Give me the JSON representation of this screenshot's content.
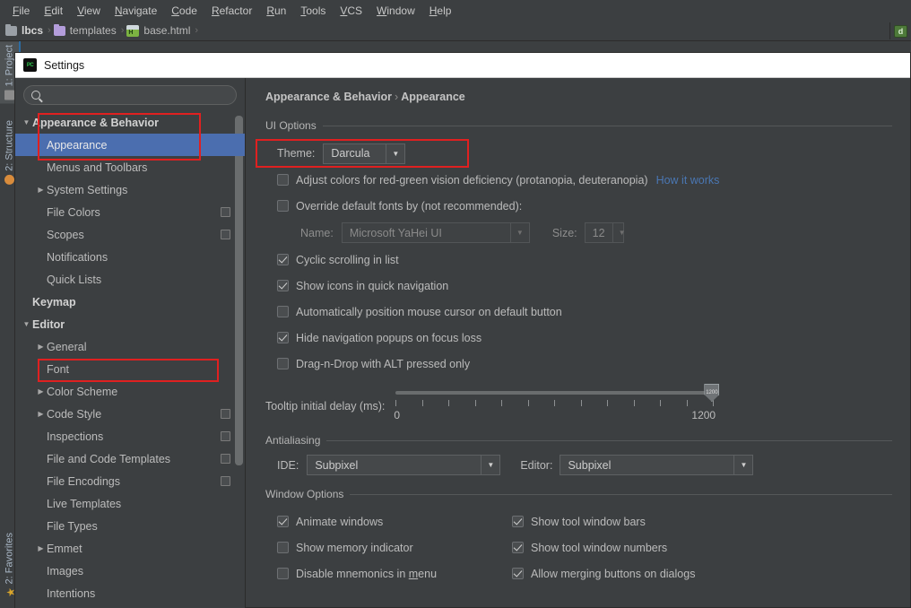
{
  "menubar": {
    "items": [
      "File",
      "Edit",
      "View",
      "Navigate",
      "Code",
      "Refactor",
      "Run",
      "Tools",
      "VCS",
      "Window",
      "Help"
    ]
  },
  "navbar": {
    "crumbs": [
      {
        "label": "lbcs",
        "icon": "folder-gray-icon"
      },
      {
        "label": "templates",
        "icon": "folder-purple-icon"
      },
      {
        "label": "base.html",
        "icon": "html-file-icon"
      }
    ],
    "separator": "›",
    "right_icon": "run-configuration-icon"
  },
  "toolstripe": {
    "buttons": [
      {
        "label": "1: Project",
        "icon": "project-icon",
        "active": true
      },
      {
        "label": "2: Structure",
        "icon": "structure-icon",
        "active": false
      },
      {
        "label": "2: Favorites",
        "icon": "star-icon",
        "active": false
      }
    ]
  },
  "dialog": {
    "icon": "pycharm-icon",
    "title": "Settings"
  },
  "search": {
    "placeholder": "",
    "value": "",
    "icon": "search-icon"
  },
  "tree": {
    "items": [
      {
        "label": "Appearance & Behavior",
        "arrow": "▼",
        "indent": 0,
        "bold": true,
        "selected": false,
        "badge": false
      },
      {
        "label": "Appearance",
        "arrow": "",
        "indent": 1,
        "bold": false,
        "selected": true,
        "badge": false
      },
      {
        "label": "Menus and Toolbars",
        "arrow": "",
        "indent": 1,
        "bold": false,
        "selected": false,
        "badge": false
      },
      {
        "label": "System Settings",
        "arrow": "▶",
        "indent": 1,
        "bold": false,
        "selected": false,
        "badge": false
      },
      {
        "label": "File Colors",
        "arrow": "",
        "indent": 1,
        "bold": false,
        "selected": false,
        "badge": true
      },
      {
        "label": "Scopes",
        "arrow": "",
        "indent": 1,
        "bold": false,
        "selected": false,
        "badge": true
      },
      {
        "label": "Notifications",
        "arrow": "",
        "indent": 1,
        "bold": false,
        "selected": false,
        "badge": false
      },
      {
        "label": "Quick Lists",
        "arrow": "",
        "indent": 1,
        "bold": false,
        "selected": false,
        "badge": false
      },
      {
        "label": "Keymap",
        "arrow": "",
        "indent": 0,
        "bold": true,
        "selected": false,
        "badge": false
      },
      {
        "label": "Editor",
        "arrow": "▼",
        "indent": 0,
        "bold": true,
        "selected": false,
        "badge": false
      },
      {
        "label": "General",
        "arrow": "▶",
        "indent": 1,
        "bold": false,
        "selected": false,
        "badge": false
      },
      {
        "label": "Font",
        "arrow": "",
        "indent": 1,
        "bold": false,
        "selected": false,
        "badge": false
      },
      {
        "label": "Color Scheme",
        "arrow": "▶",
        "indent": 1,
        "bold": false,
        "selected": false,
        "badge": false
      },
      {
        "label": "Code Style",
        "arrow": "▶",
        "indent": 1,
        "bold": false,
        "selected": false,
        "badge": true
      },
      {
        "label": "Inspections",
        "arrow": "",
        "indent": 1,
        "bold": false,
        "selected": false,
        "badge": true
      },
      {
        "label": "File and Code Templates",
        "arrow": "",
        "indent": 1,
        "bold": false,
        "selected": false,
        "badge": true
      },
      {
        "label": "File Encodings",
        "arrow": "",
        "indent": 1,
        "bold": false,
        "selected": false,
        "badge": true
      },
      {
        "label": "Live Templates",
        "arrow": "",
        "indent": 1,
        "bold": false,
        "selected": false,
        "badge": false
      },
      {
        "label": "File Types",
        "arrow": "",
        "indent": 1,
        "bold": false,
        "selected": false,
        "badge": false
      },
      {
        "label": "Emmet",
        "arrow": "▶",
        "indent": 1,
        "bold": false,
        "selected": false,
        "badge": false
      },
      {
        "label": "Images",
        "arrow": "",
        "indent": 1,
        "bold": false,
        "selected": false,
        "badge": false
      },
      {
        "label": "Intentions",
        "arrow": "",
        "indent": 1,
        "bold": false,
        "selected": false,
        "badge": false
      }
    ]
  },
  "content": {
    "breadcrumb_parent": "Appearance & Behavior",
    "breadcrumb_sep": "›",
    "breadcrumb_current": "Appearance",
    "ui_options": {
      "title": "UI Options",
      "theme_label": "Theme:",
      "theme_value": "Darcula",
      "vision_deficiency_label": "Adjust colors for red-green vision deficiency (protanopia, deuteranopia)",
      "vision_deficiency_checked": false,
      "how_it_works_link": "How it works",
      "override_fonts_label": "Override default fonts by (not recommended):",
      "override_fonts_checked": false,
      "name_label": "Name:",
      "name_value": "Microsoft YaHei UI",
      "size_label": "Size:",
      "size_value": "12",
      "checkboxes": [
        {
          "label": "Cyclic scrolling in list",
          "checked": true
        },
        {
          "label": "Show icons in quick navigation",
          "checked": true
        },
        {
          "label": "Automatically position mouse cursor on default button",
          "checked": false
        },
        {
          "label": "Hide navigation popups on focus loss",
          "checked": true
        },
        {
          "label": "Drag-n-Drop with ALT pressed only",
          "checked": false
        }
      ],
      "tooltip_delay_label": "Tooltip initial delay (ms):",
      "tooltip_delay_min": "0",
      "tooltip_delay_max": "1200",
      "tooltip_delay_value": "1200"
    },
    "antialiasing": {
      "title": "Antialiasing",
      "ide_label": "IDE:",
      "ide_value": "Subpixel",
      "editor_label": "Editor:",
      "editor_value": "Subpixel"
    },
    "window_options": {
      "title": "Window Options",
      "left": [
        {
          "label": "Animate windows",
          "checked": true
        },
        {
          "label": "Show memory indicator",
          "checked": false
        },
        {
          "label": "Disable mnemonics in menu",
          "checked": false,
          "mnemonic": "m"
        }
      ],
      "right": [
        {
          "label": "Show tool window bars",
          "checked": true
        },
        {
          "label": "Show tool window numbers",
          "checked": true
        },
        {
          "label": "Allow merging buttons on dialogs",
          "checked": true
        }
      ]
    }
  },
  "annotations": {
    "highlight_color": "#e02020",
    "boxes": [
      {
        "name": "appearance-behavior-highlight"
      },
      {
        "name": "font-highlight"
      },
      {
        "name": "theme-highlight"
      }
    ]
  }
}
